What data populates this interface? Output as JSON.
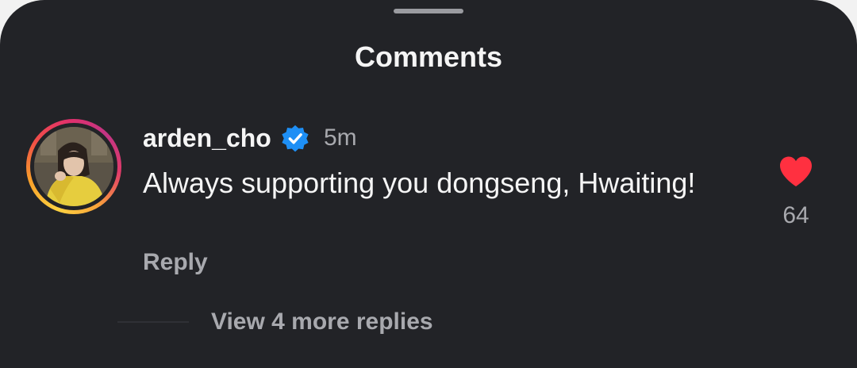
{
  "header": {
    "title": "Comments"
  },
  "comment": {
    "username": "arden_cho",
    "verified_icon": "verified-badge-icon",
    "time": "5m",
    "text": "Always supporting you dongseng, Hwaiting!",
    "reply_label": "Reply",
    "like_icon": "heart-icon",
    "like_count": "64",
    "liked": true,
    "view_replies_label": "View 4 more replies"
  },
  "colors": {
    "background": "#222327",
    "text_primary": "#f5f5f5",
    "text_secondary": "#a8a9ae",
    "like_red": "#ff3040",
    "verified_blue": "#1e8ff5"
  }
}
